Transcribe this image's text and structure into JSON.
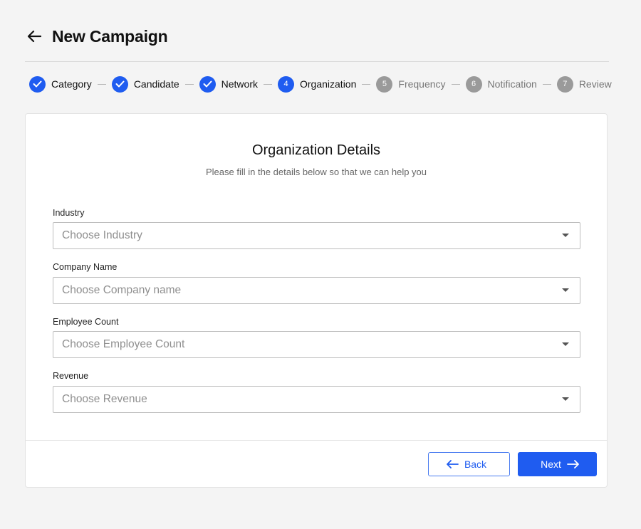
{
  "header": {
    "title": "New Campaign"
  },
  "stepper": {
    "steps": [
      {
        "label": "Category",
        "number": "1",
        "state": "done"
      },
      {
        "label": "Candidate",
        "number": "2",
        "state": "done"
      },
      {
        "label": "Network",
        "number": "3",
        "state": "done"
      },
      {
        "label": "Organization",
        "number": "4",
        "state": "active"
      },
      {
        "label": "Frequency",
        "number": "5",
        "state": "pending"
      },
      {
        "label": "Notification",
        "number": "6",
        "state": "pending"
      },
      {
        "label": "Review",
        "number": "7",
        "state": "pending"
      }
    ]
  },
  "form": {
    "title": "Organization Details",
    "subtitle": "Please fill in the details below so that we can help you",
    "fields": [
      {
        "label": "Industry",
        "placeholder": "Choose Industry"
      },
      {
        "label": "Company Name",
        "placeholder": "Choose Company name"
      },
      {
        "label": "Employee Count",
        "placeholder": "Choose Employee Count"
      },
      {
        "label": "Revenue",
        "placeholder": "Choose Revenue"
      }
    ]
  },
  "actions": {
    "back_label": "Back",
    "next_label": "Next"
  },
  "colors": {
    "accent": "#1f5cf0",
    "pending": "#9a9a9a"
  }
}
